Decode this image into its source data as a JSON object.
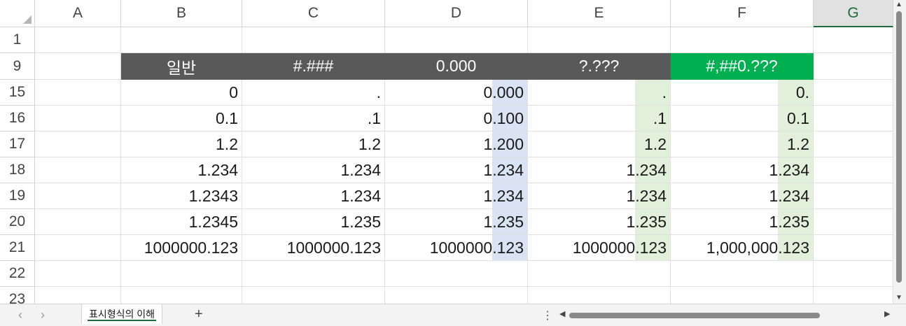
{
  "columns": [
    {
      "label": "A",
      "selected": false
    },
    {
      "label": "B",
      "selected": false
    },
    {
      "label": "C",
      "selected": false
    },
    {
      "label": "D",
      "selected": false
    },
    {
      "label": "E",
      "selected": false
    },
    {
      "label": "F",
      "selected": false
    },
    {
      "label": "G",
      "selected": true
    }
  ],
  "rows": [
    "1",
    "9",
    "15",
    "16",
    "17",
    "18",
    "19",
    "20",
    "21",
    "22",
    "23"
  ],
  "header_row": {
    "B": "일반",
    "C": "#.###",
    "D": "0.000",
    "E": "?.???",
    "F": "#,##0.???"
  },
  "data_rows": [
    {
      "B": "0",
      "C": ".",
      "D": "0.000",
      "E": ".",
      "F": "0."
    },
    {
      "B": "0.1",
      "C": ".1",
      "D": "0.100",
      "E": ".1",
      "F": "0.1"
    },
    {
      "B": "1.2",
      "C": "1.2",
      "D": "1.200",
      "E": "1.2",
      "F": "1.2"
    },
    {
      "B": "1.234",
      "C": "1.234",
      "D": "1.234",
      "E": "1.234",
      "F": "1.234"
    },
    {
      "B": "1.2343",
      "C": "1.234",
      "D": "1.234",
      "E": "1.234",
      "F": "1.234"
    },
    {
      "B": "1.2345",
      "C": "1.235",
      "D": "1.235",
      "E": "1.235",
      "F": "1.235"
    },
    {
      "B": "1000000.123",
      "C": "1000000.123",
      "D": "1000000.123",
      "E": "1000000.123",
      "F": "1,000,000.123"
    }
  ],
  "colors": {
    "header_dark": "#595959",
    "header_green": "#00b050",
    "highlight_blue": "#dae3f3",
    "highlight_green": "#e2efda",
    "accent": "#1e6b3a"
  },
  "sheet_tab": {
    "label": "표시형식의 이해",
    "active": true
  },
  "icons": {
    "prev_sheet": "chevron-left-icon",
    "next_sheet": "chevron-right-icon",
    "add_sheet": "plus-icon",
    "options": "vertical-dots-icon"
  },
  "glyphs": {
    "prev": "‹",
    "next": "›",
    "add": "+",
    "dots": "⋮",
    "left": "◀",
    "right": "▶",
    "up": "▲",
    "down": "▼"
  }
}
